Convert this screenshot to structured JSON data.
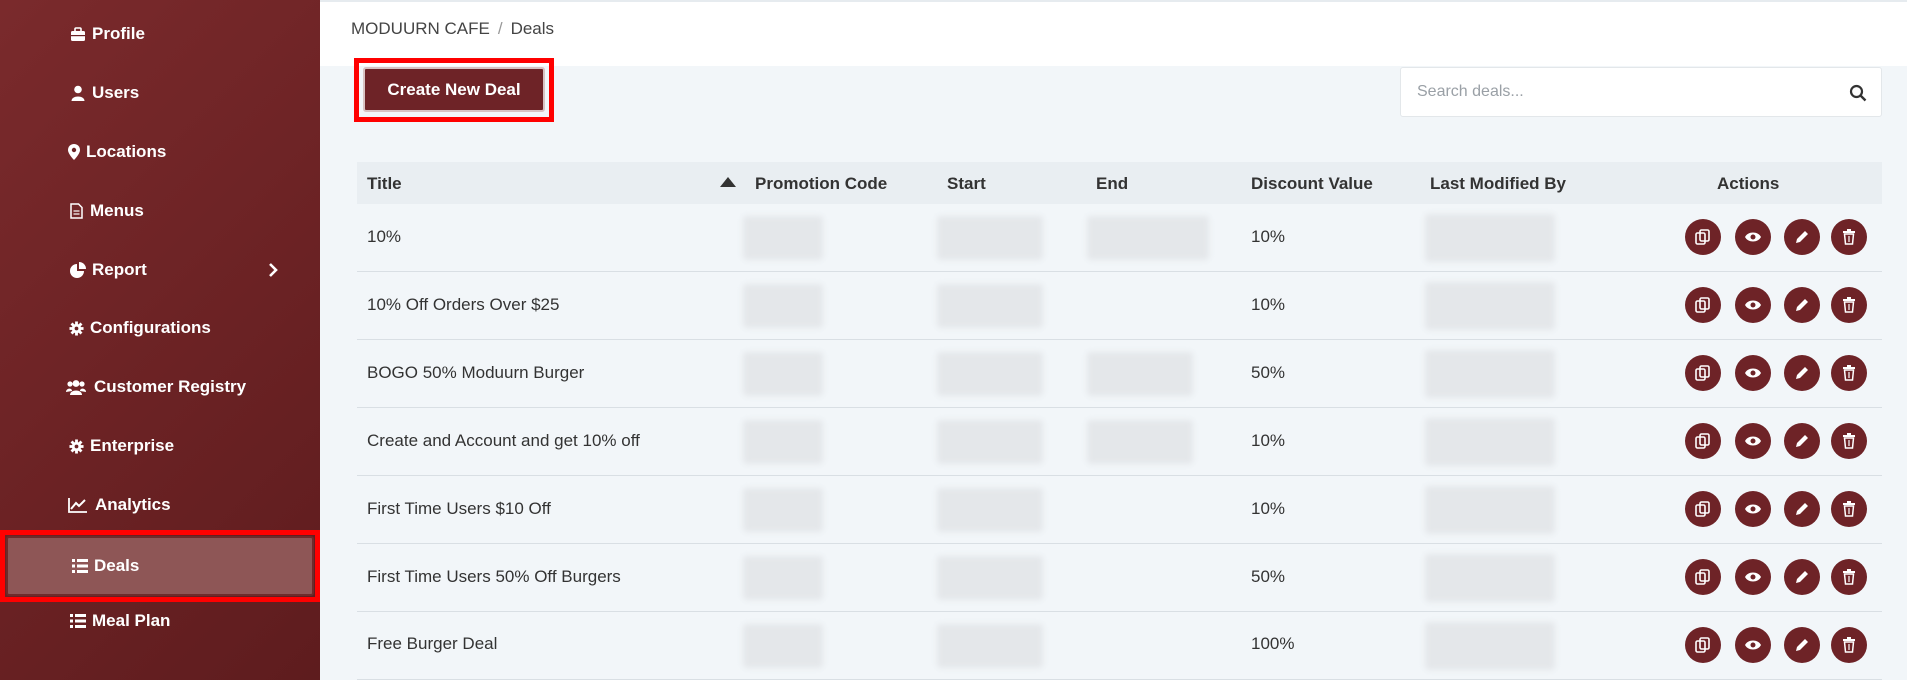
{
  "sidebar": {
    "items": [
      {
        "label": "Profile",
        "icon": "briefcase-icon"
      },
      {
        "label": "Users",
        "icon": "user-icon"
      },
      {
        "label": "Locations",
        "icon": "map-pin-icon"
      },
      {
        "label": "Menus",
        "icon": "document-icon"
      },
      {
        "label": "Report",
        "icon": "pie-chart-icon",
        "has_submenu": true
      },
      {
        "label": "Configurations",
        "icon": "gear-icon"
      },
      {
        "label": "Customer Registry",
        "icon": "users-icon"
      },
      {
        "label": "Enterprise",
        "icon": "gear-icon"
      },
      {
        "label": "Analytics",
        "icon": "line-chart-icon"
      },
      {
        "label": "Deals",
        "icon": "list-icon",
        "active": true
      },
      {
        "label": "Meal Plan",
        "icon": "list-icon"
      }
    ]
  },
  "breadcrumb": {
    "root": "MODUURN CAFE",
    "separator": "/",
    "current": "Deals"
  },
  "toolbar": {
    "create_label": "Create New Deal"
  },
  "search": {
    "placeholder": "Search deals..."
  },
  "table": {
    "headers": {
      "title": "Title",
      "promotion_code": "Promotion Code",
      "start": "Start",
      "end": "End",
      "discount_value": "Discount Value",
      "last_modified_by": "Last Modified By",
      "actions": "Actions"
    },
    "sort": {
      "column": "Title",
      "direction": "ascending"
    },
    "rows": [
      {
        "title": "10%",
        "discount": "10%"
      },
      {
        "title": "10% Off Orders Over $25",
        "discount": "10%"
      },
      {
        "title": "BOGO 50% Moduurn Burger",
        "discount": "50%"
      },
      {
        "title": "Create and Account and get 10% off",
        "discount": "10%"
      },
      {
        "title": "First Time Users $10 Off",
        "discount": "10%"
      },
      {
        "title": "First Time Users 50% Off Burgers",
        "discount": "50%"
      },
      {
        "title": "Free Burger Deal",
        "discount": "100%"
      }
    ],
    "row_actions": [
      "copy-icon",
      "eye-icon",
      "pencil-icon",
      "trash-icon"
    ]
  },
  "colors": {
    "sidebar": "#6b2224",
    "sidebar_active": "#8e5656",
    "accent": "#6e2327",
    "highlight": "#ff0000"
  }
}
